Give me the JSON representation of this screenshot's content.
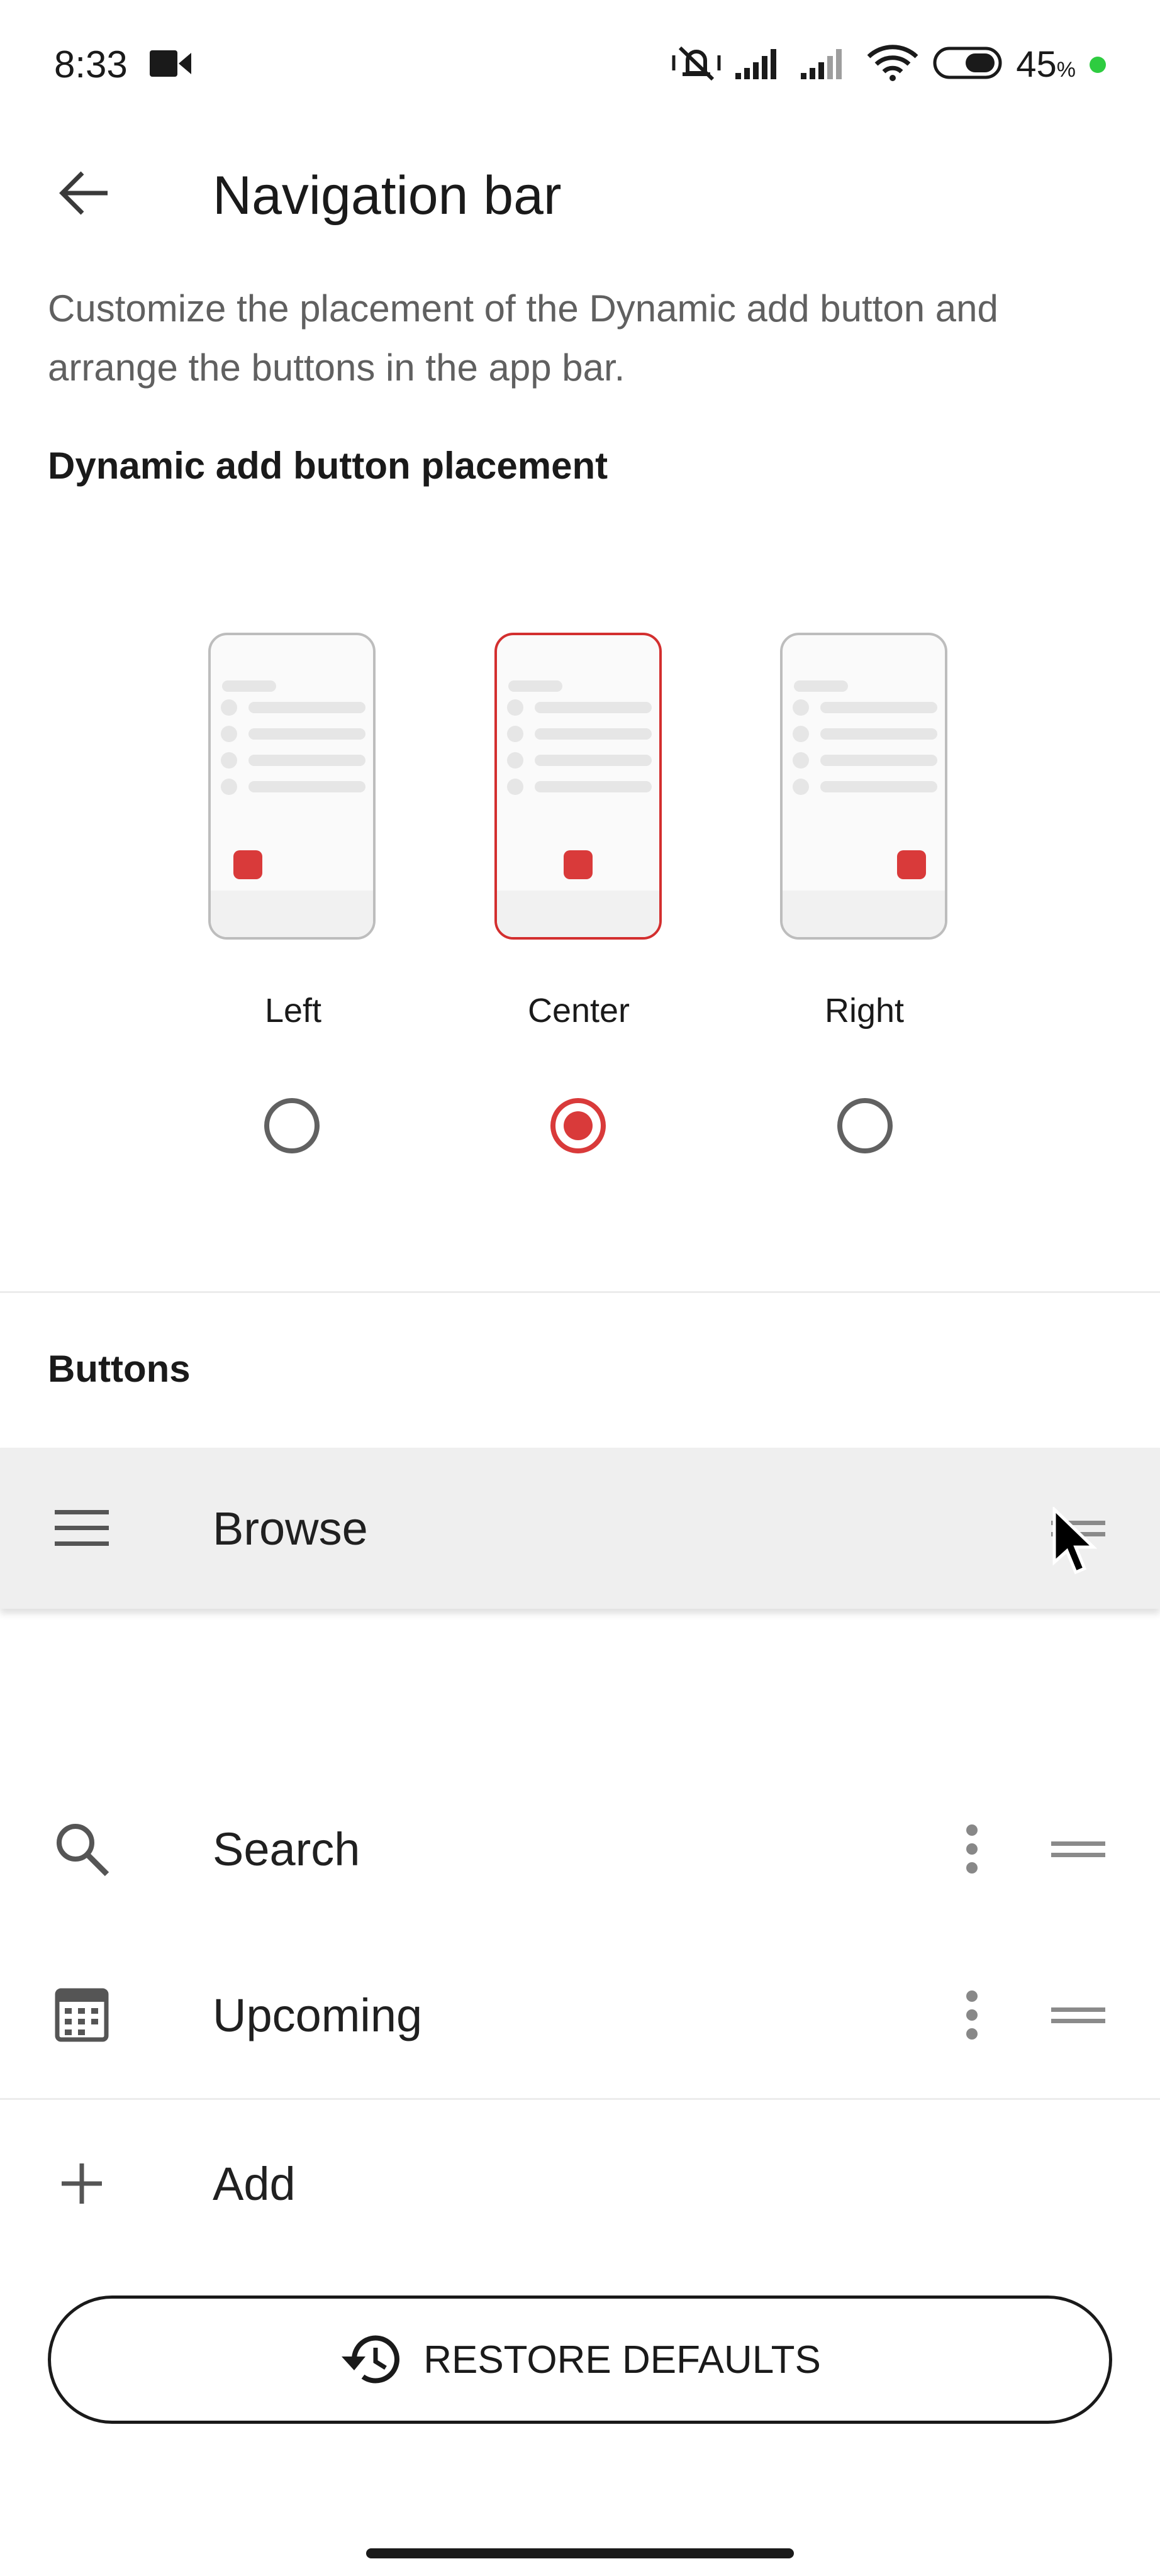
{
  "status_bar": {
    "time": "8:33",
    "battery_percent": "45",
    "battery_suffix": "%"
  },
  "app_bar": {
    "title": "Navigation bar"
  },
  "description": "Customize the placement of the Dynamic add button and arrange the buttons in the app bar.",
  "placement": {
    "section_title": "Dynamic add button placement",
    "options": [
      {
        "label": "Left",
        "selected": false
      },
      {
        "label": "Center",
        "selected": true
      },
      {
        "label": "Right",
        "selected": false
      }
    ]
  },
  "buttons_section": {
    "title": "Buttons",
    "items": [
      {
        "label": "Browse",
        "icon": "menu-icon",
        "dragging": true
      },
      {
        "label": "Search",
        "icon": "search-icon",
        "dragging": false
      },
      {
        "label": "Upcoming",
        "icon": "calendar-icon",
        "dragging": false
      }
    ],
    "add_label": "Add"
  },
  "restore_button": {
    "label": "RESTORE DEFAULTS",
    "icon": "history-icon"
  },
  "colors": {
    "accent": "#d93a3a",
    "text": "#202020",
    "secondary_text": "#606060"
  }
}
